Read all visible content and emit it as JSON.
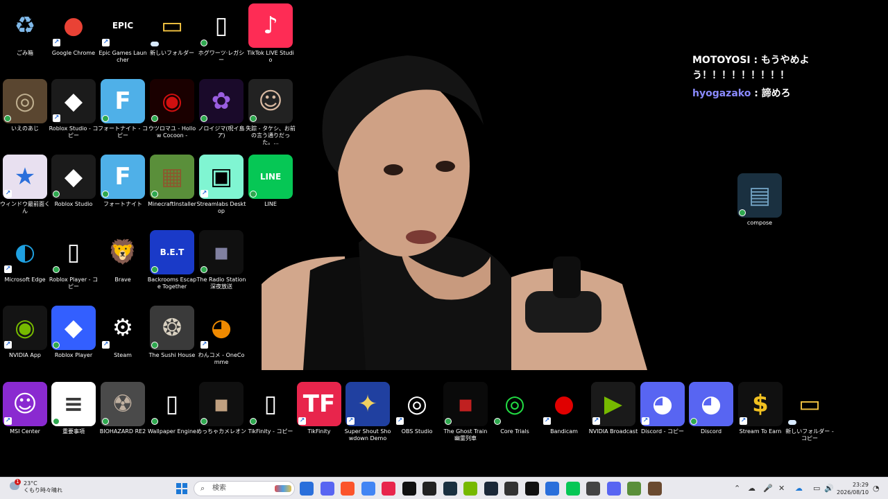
{
  "desktop_icons": [
    {
      "id": "recycle",
      "label": "ごみ箱",
      "icon": "recycle-bin-icon",
      "bg": "#000000",
      "fg": "#7fb8e8",
      "glyph": "♻",
      "overlay": "none"
    },
    {
      "id": "chrome",
      "label": "Google Chrome",
      "icon": "chrome-icon",
      "bg": "#000000",
      "fg": "#e94235",
      "glyph": "●",
      "overlay": "shortcut"
    },
    {
      "id": "epic",
      "label": "Epic Games Launcher",
      "icon": "epic-games-icon",
      "bg": "#000000",
      "fg": "#ffffff",
      "glyph": "EPIC",
      "overlay": "shortcut"
    },
    {
      "id": "newfolder1",
      "label": "新しいフォルダー",
      "icon": "folder-icon",
      "bg": "#000000",
      "fg": "#f5c542",
      "glyph": "▭",
      "overlay": "cloud"
    },
    {
      "id": "hogwarts",
      "label": "ホグワーツ·レガシー",
      "icon": "document-icon",
      "bg": "#000000",
      "fg": "#ffffff",
      "glyph": "▯",
      "overlay": "check"
    },
    {
      "id": "tiktoklive",
      "label": "TikTok LIVE Studio",
      "icon": "tiktok-live-icon",
      "bg": "#fe2c55",
      "fg": "#ffffff",
      "glyph": "♪",
      "overlay": "none"
    },
    {
      "id": "ienoaji",
      "label": "いえのあじ",
      "icon": "game-thumbnail-icon",
      "bg": "#5a4630",
      "fg": "#c0b090",
      "glyph": "◎",
      "overlay": "check"
    },
    {
      "id": "robloxstudiocopy",
      "label": "Roblox Studio - コピー",
      "icon": "roblox-studio-icon",
      "bg": "#1b1b1b",
      "fg": "#ffffff",
      "glyph": "◆",
      "overlay": "shortcut"
    },
    {
      "id": "fortnitecopy",
      "label": "フォートナイト - コピー",
      "icon": "fortnite-icon",
      "bg": "#4fb0e8",
      "fg": "#ffffff",
      "glyph": "F",
      "overlay": "check"
    },
    {
      "id": "utsuromayu",
      "label": "ウツロマユ - Hollow Cocoon -",
      "icon": "hollow-cocoon-icon",
      "bg": "#1a0000",
      "fg": "#d01010",
      "glyph": "◉",
      "overlay": "check"
    },
    {
      "id": "noroijima",
      "label": "ノロイジマ(呪イ島ア)",
      "icon": "noroijima-icon",
      "bg": "#1a0a2a",
      "fg": "#9a5ee0",
      "glyph": "✿",
      "overlay": "check"
    },
    {
      "id": "shissou",
      "label": "失踪 - タケシ、お前の言う通りだった。...",
      "icon": "face-thumbnail-icon",
      "bg": "#222222",
      "fg": "#d8b8a0",
      "glyph": "☺",
      "overlay": "check"
    },
    {
      "id": "windowsaizen",
      "label": "ウィンドウ最前面くん",
      "icon": "window-star-icon",
      "bg": "#e8e0f0",
      "fg": "#2a6fdb",
      "glyph": "★",
      "overlay": "shortcut"
    },
    {
      "id": "robloxstudio",
      "label": "Roblox Studio",
      "icon": "roblox-studio-icon",
      "bg": "#1b1b1b",
      "fg": "#ffffff",
      "glyph": "◆",
      "overlay": "check"
    },
    {
      "id": "fortnite",
      "label": "フォートナイト",
      "icon": "fortnite-icon",
      "bg": "#4fb0e8",
      "fg": "#ffffff",
      "glyph": "F",
      "overlay": "check"
    },
    {
      "id": "minecraft",
      "label": "MinecraftInstaller",
      "icon": "minecraft-icon",
      "bg": "#5a8f3a",
      "fg": "#8a5a2e",
      "glyph": "▦",
      "overlay": "check"
    },
    {
      "id": "streamlabs",
      "label": "Streamlabs Desktop",
      "icon": "streamlabs-icon",
      "bg": "#80f5d2",
      "fg": "#000000",
      "glyph": "▣",
      "overlay": "shortcut"
    },
    {
      "id": "line",
      "label": "LINE",
      "icon": "line-icon",
      "bg": "#06c755",
      "fg": "#ffffff",
      "glyph": "LINE",
      "overlay": "check"
    },
    {
      "id": "edge",
      "label": "Microsoft Edge",
      "icon": "edge-icon",
      "bg": "#000000",
      "fg": "#1fa0e0",
      "glyph": "◐",
      "overlay": "shortcut"
    },
    {
      "id": "robloxplayercopy",
      "label": "Roblox Player - コピー",
      "icon": "document-icon",
      "bg": "#000000",
      "fg": "#ffffff",
      "glyph": "▯",
      "overlay": "check"
    },
    {
      "id": "brave",
      "label": "Brave",
      "icon": "brave-icon",
      "bg": "#000000",
      "fg": "#fb542b",
      "glyph": "🦁",
      "overlay": "none"
    },
    {
      "id": "bet",
      "label": "Backrooms Escape Together",
      "icon": "bet-icon",
      "bg": "#1a3ac8",
      "fg": "#ffffff",
      "glyph": "B.E.T",
      "overlay": "check"
    },
    {
      "id": "radiostation",
      "label": "The Radio Station 深夜放送",
      "icon": "radio-station-icon",
      "bg": "#101010",
      "fg": "#8080a0",
      "glyph": "▪",
      "overlay": "check"
    },
    {
      "id": "nvidiaapp",
      "label": "NVIDIA App",
      "icon": "nvidia-icon",
      "bg": "#141414",
      "fg": "#76b900",
      "glyph": "◉",
      "overlay": "shortcut"
    },
    {
      "id": "robloxplayer",
      "label": "Roblox Player",
      "icon": "roblox-player-icon",
      "bg": "#335fff",
      "fg": "#ffffff",
      "glyph": "◆",
      "overlay": "check"
    },
    {
      "id": "steam",
      "label": "Steam",
      "icon": "steam-icon",
      "bg": "#000000",
      "fg": "#ffffff",
      "glyph": "⚙",
      "overlay": "shortcut"
    },
    {
      "id": "sushihouse",
      "label": "The Sushi House",
      "icon": "sushi-house-icon",
      "bg": "#3a3a3a",
      "fg": "#d8d0c0",
      "glyph": "❂",
      "overlay": "check"
    },
    {
      "id": "onecomme",
      "label": "わんコメ - OneComme",
      "icon": "onecomme-icon",
      "bg": "#000000",
      "fg": "#f08a00",
      "glyph": "◕",
      "overlay": "shortcut"
    },
    {
      "id": "msicenter",
      "label": "MSI Center",
      "icon": "msi-center-icon",
      "bg": "#8a2ad0",
      "fg": "#ffffff",
      "glyph": "☺",
      "overlay": "shortcut"
    },
    {
      "id": "juuyoujikou",
      "label": "重要事項",
      "icon": "document-thumbnail-icon",
      "bg": "#ffffff",
      "fg": "#3a3a3a",
      "glyph": "≡",
      "overlay": "check"
    },
    {
      "id": "biohazard",
      "label": "BIOHAZARD RE2",
      "icon": "biohazard-icon",
      "bg": "#4a4a4a",
      "fg": "#c0b0a0",
      "glyph": "☢",
      "overlay": "check"
    },
    {
      "id": "wallpaper",
      "label": "Wallpaper Engine",
      "icon": "document-icon",
      "bg": "#000000",
      "fg": "#ffffff",
      "glyph": "▯",
      "overlay": "check"
    },
    {
      "id": "meccha",
      "label": "めっちゃカメレオン",
      "icon": "chameleon-icon",
      "bg": "#101010",
      "fg": "#c0a080",
      "glyph": "▪",
      "overlay": "check"
    },
    {
      "id": "tikfinitycopy",
      "label": "TikFinity - コピー",
      "icon": "document-icon",
      "bg": "#000000",
      "fg": "#ffffff",
      "glyph": "▯",
      "overlay": "check"
    },
    {
      "id": "tikfinity",
      "label": "TikFinity",
      "icon": "tikfinity-icon",
      "bg": "#e8254c",
      "fg": "#ffffff",
      "glyph": "TF",
      "overlay": "shortcut"
    },
    {
      "id": "supershout",
      "label": "Super Shout Showdown Demo",
      "icon": "super-shout-icon",
      "bg": "#2040a0",
      "fg": "#f0d060",
      "glyph": "✦",
      "overlay": "shortcut"
    },
    {
      "id": "obs",
      "label": "OBS Studio",
      "icon": "obs-icon",
      "bg": "#000000",
      "fg": "#ffffff",
      "glyph": "◎",
      "overlay": "shortcut"
    },
    {
      "id": "ghosttrain",
      "label": "The Ghost Train 幽霊列車",
      "icon": "ghost-train-icon",
      "bg": "#0a0a0a",
      "fg": "#c02020",
      "glyph": "▪",
      "overlay": "check"
    },
    {
      "id": "coretrials",
      "label": "Core Trials",
      "icon": "core-trials-icon",
      "bg": "#000000",
      "fg": "#22dd44",
      "glyph": "◎",
      "overlay": "check"
    },
    {
      "id": "bandicam",
      "label": "Bandicam",
      "icon": "bandicam-icon",
      "bg": "#000000",
      "fg": "#e00000",
      "glyph": "●",
      "overlay": "shortcut"
    },
    {
      "id": "nvidiabroadcast",
      "label": "NVIDIA Broadcast",
      "icon": "nvidia-broadcast-icon",
      "bg": "#1a1a1a",
      "fg": "#76b900",
      "glyph": "▶",
      "overlay": "shortcut"
    },
    {
      "id": "discordcopy",
      "label": "Discord - コピー",
      "icon": "discord-icon",
      "bg": "#5865f2",
      "fg": "#ffffff",
      "glyph": "◕",
      "overlay": "shortcut"
    },
    {
      "id": "discord",
      "label": "Discord",
      "icon": "discord-icon",
      "bg": "#5865f2",
      "fg": "#ffffff",
      "glyph": "◕",
      "overlay": "check"
    },
    {
      "id": "streamtoearn",
      "label": "Stream To Earn",
      "icon": "stream-to-earn-icon",
      "bg": "#101010",
      "fg": "#f0c020",
      "glyph": "$",
      "overlay": "shortcut"
    },
    {
      "id": "newfoldercopy",
      "label": "新しいフォルダー - コピー",
      "icon": "folder-icon",
      "bg": "#000000",
      "fg": "#f5c542",
      "glyph": "▭",
      "overlay": "cloud"
    },
    {
      "id": "compose",
      "label": "compose",
      "icon": "compose-thumbnail-icon",
      "bg": "#1a3040",
      "fg": "#70a0c0",
      "glyph": "▤",
      "overlay": "check"
    }
  ],
  "chat": [
    {
      "name": "MOTOYOSI",
      "separator": " : ",
      "text": "もうやめよう！！！！！！！！！"
    },
    {
      "name": "hyogazako",
      "separator": " : ",
      "text": "諦めろ"
    }
  ],
  "taskbar": {
    "weather_temp": "23°C",
    "weather_text": "くもり時々晴れ",
    "weather_badge": "1",
    "search_placeholder": "検索",
    "time": "23:29",
    "date": "2026/08/10"
  },
  "taskbar_apps": [
    "start",
    "search",
    "widgets",
    "task-view",
    "file-explorer",
    "roblox",
    "brave",
    "chrome",
    "tikfinity",
    "tiktok",
    "ghost-train",
    "compose",
    "nvidia",
    "steam",
    "davinci",
    "bandicam",
    "window-star",
    "line",
    "game",
    "discord",
    "minecraft",
    "game2"
  ],
  "colors": {
    "accent": "#2a6fdb",
    "chat_name_2": "#8a8aff"
  }
}
